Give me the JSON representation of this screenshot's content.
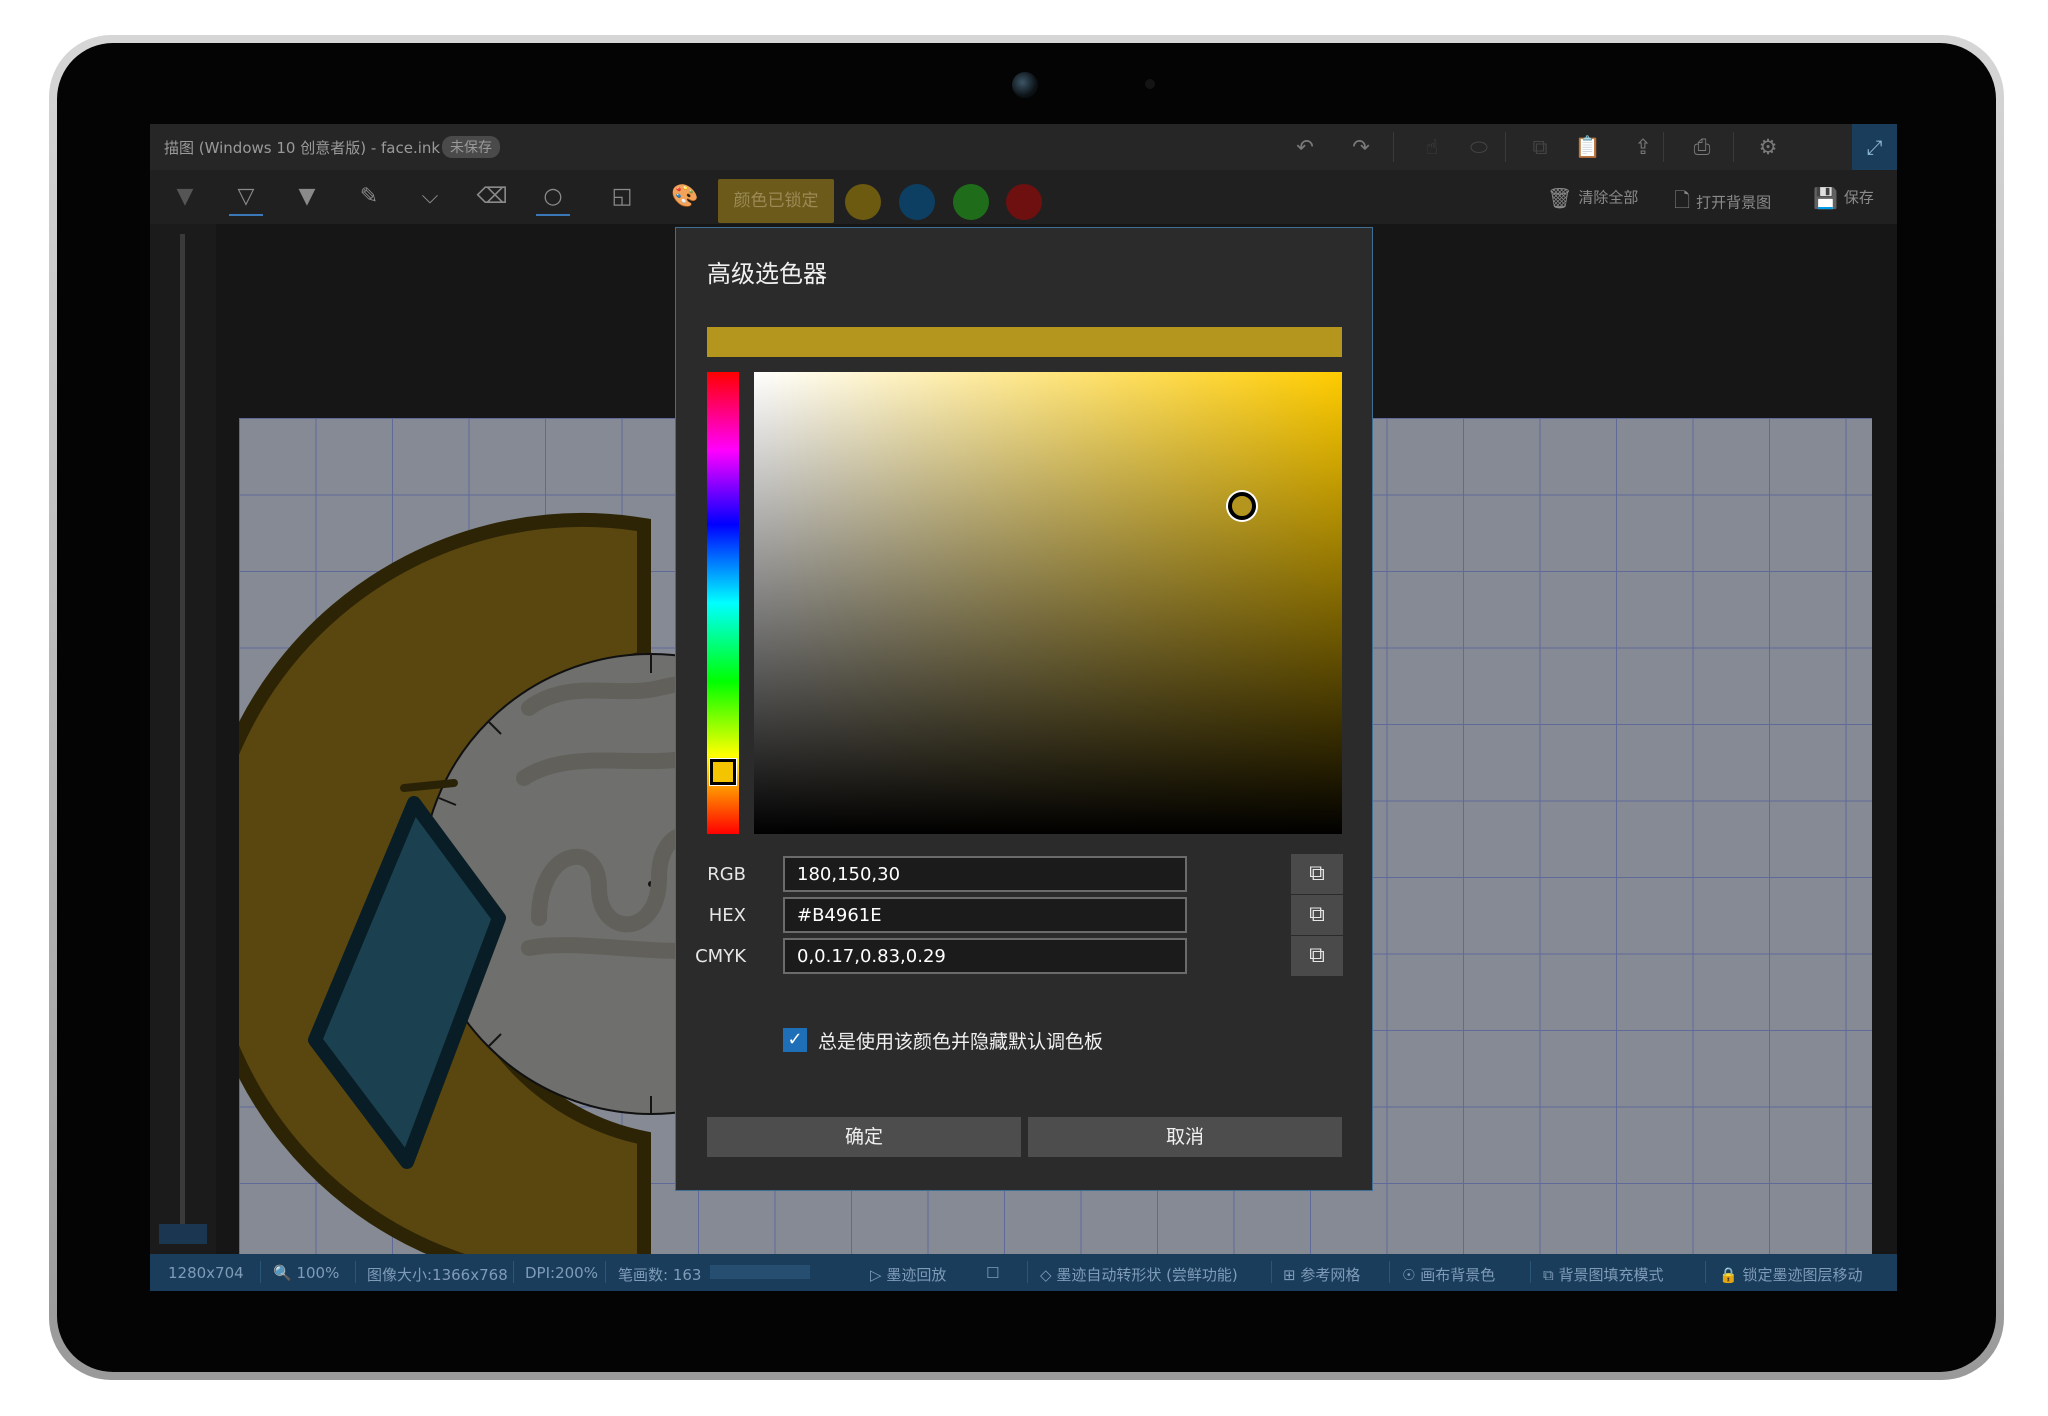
{
  "window": {
    "title": "描图 (Windows 10 创意者版) - face.ink",
    "unsaved_badge": "未保存",
    "icons": [
      "undo-icon",
      "redo-icon",
      "touch-icon",
      "mouse-icon",
      "copy-icon",
      "paste-icon",
      "share-icon",
      "print-icon",
      "gear-icon",
      "fullscreen-icon"
    ]
  },
  "toolbar": {
    "locked_color_label": "颜色已锁定",
    "swatches": [
      "#6c5a10",
      "#0d3f63",
      "#1f6d1a",
      "#6e1010"
    ],
    "clear_all": "清除全部",
    "open_background": "打开背景图",
    "save": "保存"
  },
  "dialog": {
    "title": "高级选色器",
    "preview_color": "#B4961E",
    "rgb_label": "RGB",
    "rgb_value": "180,150,30",
    "hex_label": "HEX",
    "hex_value": "#B4961E",
    "cmyk_label": "CMYK",
    "cmyk_value": "0,0.17,0.83,0.29",
    "always_use_label": "总是使用该颜色并隐藏默认调色板",
    "always_use_checked": true,
    "hue": 48,
    "saturation": 0.83,
    "value": 0.71,
    "hue_square_color": "#ffcc00",
    "ok_label": "确定",
    "cancel_label": "取消"
  },
  "statusbar": {
    "canvas_size": "1280x704",
    "zoom": "100%",
    "image_size": "图像大小:1366x768",
    "dpi": "DPI:200%",
    "stroke_count": "笔画数: 163",
    "ink_replay": "墨迹回放",
    "auto_shape": "墨迹自动转形状 (尝鲜功能)",
    "reference_grid": "参考网格",
    "canvas_bg_color": "画布背景色",
    "bg_fill_mode": "背景图填充模式",
    "lock_ink_layer": "锁定墨迹图层移动"
  }
}
